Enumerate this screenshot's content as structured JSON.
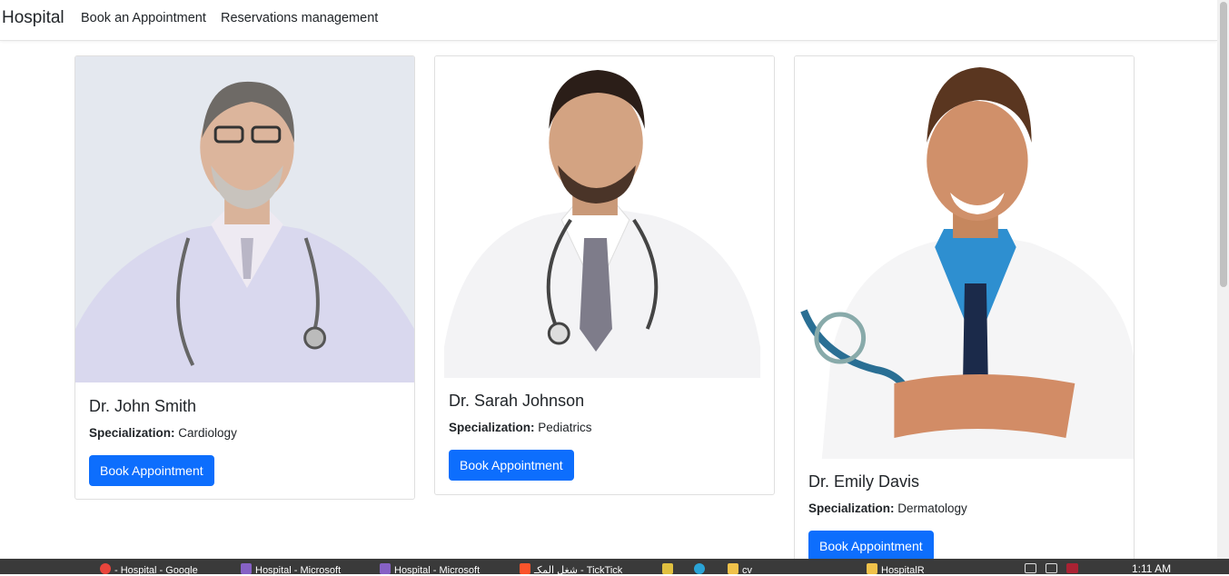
{
  "navbar": {
    "brand": "Hospital",
    "links": [
      "Book an Appointment",
      "Reservations management"
    ]
  },
  "doctors": [
    {
      "name": "Dr. John Smith",
      "spec_label": "Specialization:",
      "specialization": "Cardiology",
      "button": "Book Appointment"
    },
    {
      "name": "Dr. Sarah Johnson",
      "spec_label": "Specialization:",
      "specialization": "Pediatrics",
      "button": "Book Appointment"
    },
    {
      "name": "Dr. Emily Davis",
      "spec_label": "Specialization:",
      "specialization": "Dermatology",
      "button": "Book Appointment"
    }
  ],
  "taskbar": {
    "items": [
      "- Hospital - Google",
      "Hospital - Microsoft",
      "Hospital - Microsoft",
      "شغل المكـ - TickTick",
      "cv",
      "HospitalR"
    ],
    "clock": "1:11 AM"
  },
  "colors": {
    "primary": "#0d6efd",
    "taskbar": "#3a3a3a"
  }
}
